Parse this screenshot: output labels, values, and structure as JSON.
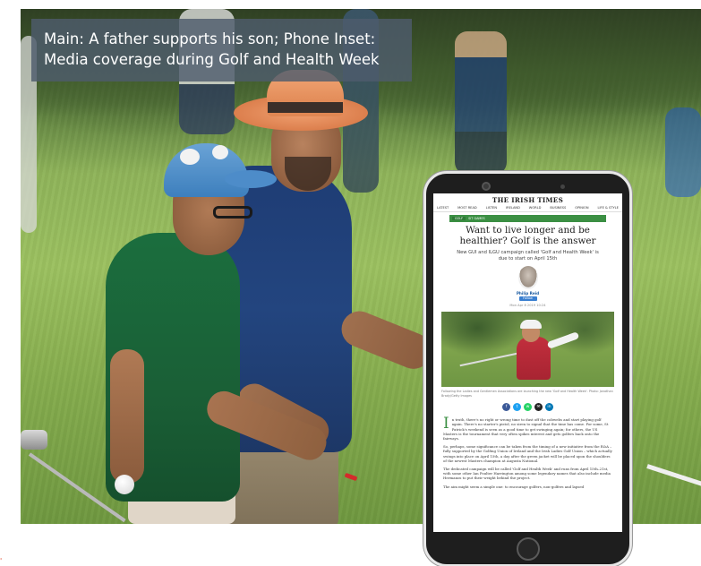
{
  "caption": {
    "line1": "Main: A father supports his son; Phone Inset:",
    "line2": "Media coverage during Golf and Health Week"
  },
  "phone_article": {
    "masthead": "THE IRISH TIMES",
    "nav": [
      "LATEST",
      "MOST READ",
      "LISTEN",
      "IRELAND",
      "WORLD",
      "BUSINESS",
      "OPINION",
      "LIFE & STYLE"
    ],
    "section_tag": "GOLF",
    "section_subtag": "SIT GAMES",
    "headline": "Want to live longer and be healthier? Golf is the answer",
    "standfirst": "New GUI and ILGU campaign called 'Golf and Health Week' is due to start on April 15th",
    "author": "Philip Reid",
    "follow_label": "Follow",
    "dateline": "Mon Apr 8 2019 10:24",
    "photo_caption": "Following the Ladies and Gentlemen Associations are launching the new 'Golf and Health Week'. Photo: Jonathan Brady/Getty Images",
    "share_icons": [
      "facebook-icon",
      "twitter-icon",
      "whatsapp-icon",
      "email-icon",
      "linkedin-icon"
    ],
    "body": [
      "n truth, there's no right or wrong time to dust off the cobwebs and start playing golf again. There's no starter's pistol, no siren to signal that the time has come. For some, St Patrick's weekend is seen as a good time to get swinging again; for others, the US Masters is the tournament that very often spikes interest and gets golfers back onto the fairways.",
      "So, perhaps, some significance can be taken from the timing of a new initiative from the R&A – fully supported by the Golfing Union of Ireland and the Irish Ladies Golf Union – which actually swings into place on April 15th, a day after the green jacket will be placed upon the shoulders of the newest Masters champion at Augusta National.",
      "The dedicated campaign will be called 'Golf and Health Week' and runs from April 15th–21st, with some other Ian Poulter Harrington among some legendary names that also include media Hermanos to put their weight behind the project.",
      "The aim might seem a simple one: to encourage golfers, non-golfers and lapsed"
    ]
  },
  "colors": {
    "caption_bg": "#4e5c6c",
    "brand_green": "#3b8f43",
    "link_blue": "#1a5aa0"
  }
}
